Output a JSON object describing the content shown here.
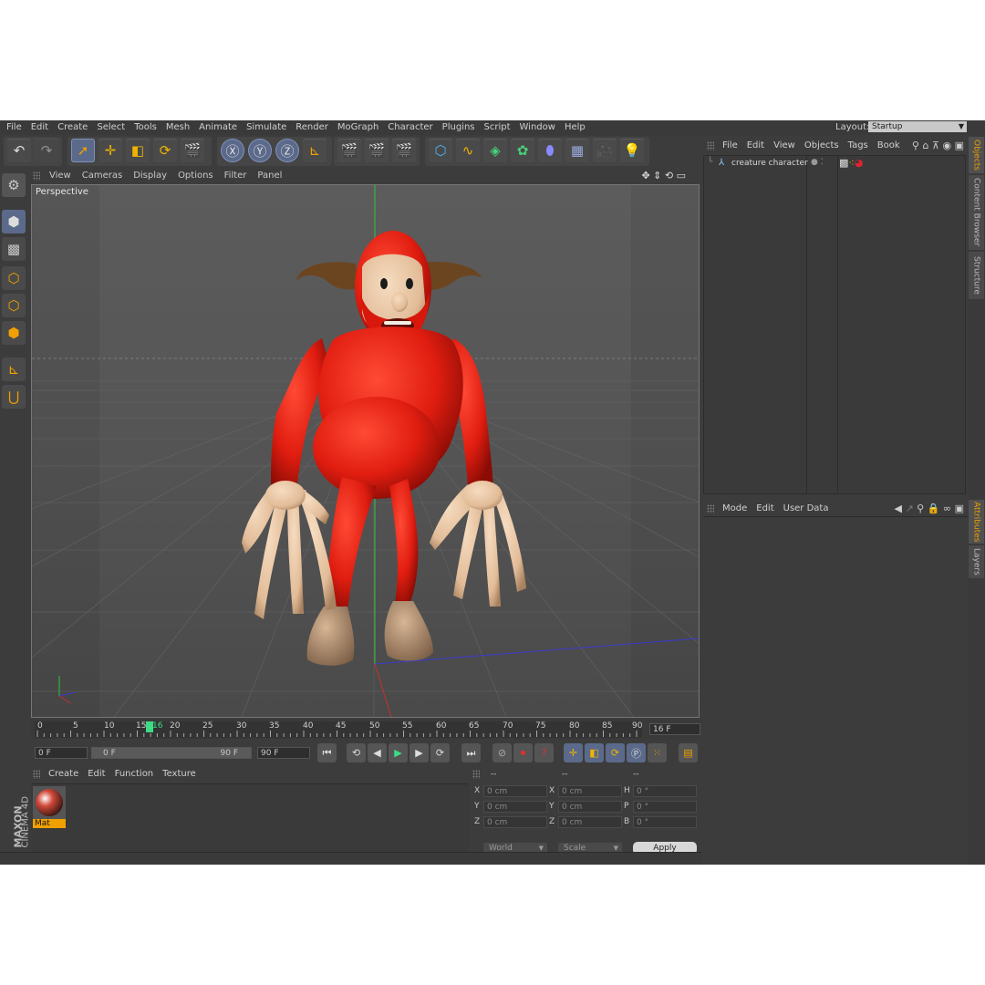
{
  "menubar": {
    "items": [
      "File",
      "Edit",
      "Create",
      "Select",
      "Tools",
      "Mesh",
      "Animate",
      "Simulate",
      "Render",
      "MoGraph",
      "Character",
      "Plugins",
      "Script",
      "Window",
      "Help"
    ],
    "layout_label": "Layout:",
    "layout_value": "Startup"
  },
  "viewport": {
    "menu": [
      "View",
      "Cameras",
      "Display",
      "Options",
      "Filter",
      "Panel"
    ],
    "label": "Perspective"
  },
  "timeline": {
    "ticks": [
      "0",
      "5",
      "10",
      "15",
      "16",
      "20",
      "25",
      "30",
      "35",
      "40",
      "45",
      "50",
      "55",
      "60",
      "65",
      "70",
      "75",
      "80",
      "85",
      "90"
    ],
    "current_frame": "16 F"
  },
  "transport": {
    "start_field": "0 F",
    "range_start": "0 F",
    "range_end": "90 F",
    "end_field": "90 F"
  },
  "material_manager": {
    "menu": [
      "Create",
      "Edit",
      "Function",
      "Texture"
    ],
    "material_name": "Mat"
  },
  "brand": {
    "line1": "MAXON",
    "line2": "CINEMA 4D"
  },
  "coordinates": {
    "headers": [
      "--",
      "--",
      "--"
    ],
    "rows": [
      {
        "a": "X",
        "av": "0 cm",
        "b": "X",
        "bv": "0 cm",
        "c": "H",
        "cv": "0 °"
      },
      {
        "a": "Y",
        "av": "0 cm",
        "b": "Y",
        "bv": "0 cm",
        "c": "P",
        "cv": "0 °"
      },
      {
        "a": "Z",
        "av": "0 cm",
        "b": "Z",
        "bv": "0 cm",
        "c": "B",
        "cv": "0 °"
      }
    ],
    "mode_world": "World",
    "mode_scale": "Scale",
    "apply_label": "Apply"
  },
  "object_manager": {
    "menu": [
      "File",
      "Edit",
      "View",
      "Objects",
      "Tags",
      "Book"
    ],
    "objects": [
      {
        "name": "creature character"
      }
    ]
  },
  "attribute_manager": {
    "menu": [
      "Mode",
      "Edit",
      "User Data"
    ]
  },
  "right_tabs": {
    "objects": "Objects",
    "content_browser": "Content Browser",
    "structure": "Structure",
    "attributes": "Attributes",
    "layers": "Layers"
  },
  "colors": {
    "ui_bg": "#3c3c3c",
    "accent": "#f0a000",
    "character_red": "#e01d10",
    "skin": "#e8c7a4",
    "playhead": "#3ddc84"
  }
}
